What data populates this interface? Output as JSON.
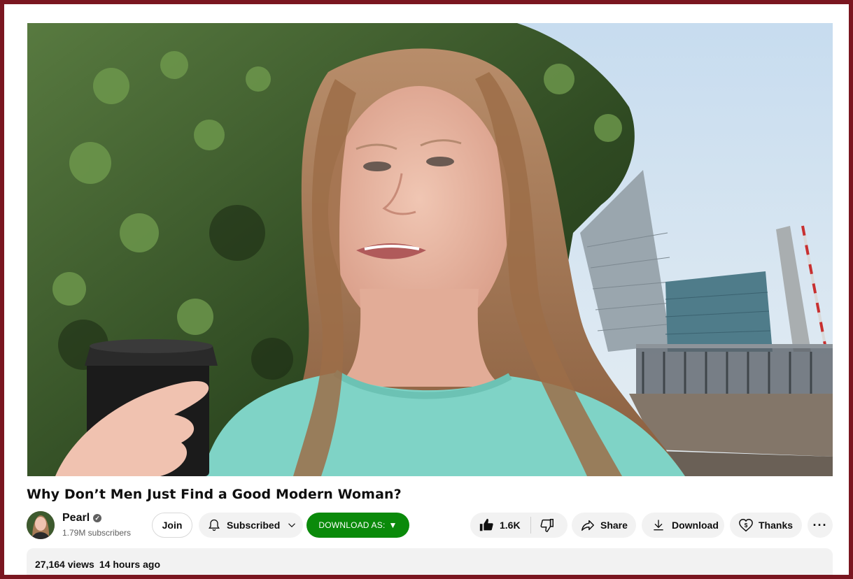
{
  "video": {
    "title": "Why Don’t Men Just Find a Good Modern Woman?"
  },
  "channel": {
    "name": "Pearl",
    "subscribers": "1.79M subscribers",
    "verified": true
  },
  "actions": {
    "join_label": "Join",
    "subscribed_label": "Subscribed",
    "download_as_label": "DOWNLOAD AS:",
    "download_as_arrow": "▼",
    "like_count": "1.6K",
    "share_label": "Share",
    "download_label": "Download",
    "thanks_label": "Thanks",
    "more_label": "···"
  },
  "info": {
    "views": "27,164 views",
    "posted": "14 hours ago"
  },
  "colors": {
    "frame_border": "#7a1620",
    "download_as_bg": "#0a8a0a",
    "pill_bg": "#f2f2f2"
  },
  "icons": {
    "verified": "check-circle-icon",
    "bell": "bell-icon",
    "chevron": "chevron-down-icon",
    "like": "thumbs-up-icon",
    "dislike": "thumbs-down-icon",
    "share": "share-arrow-icon",
    "download": "download-arrow-icon",
    "thanks": "heart-dollar-icon",
    "more": "more-horizontal-icon"
  }
}
